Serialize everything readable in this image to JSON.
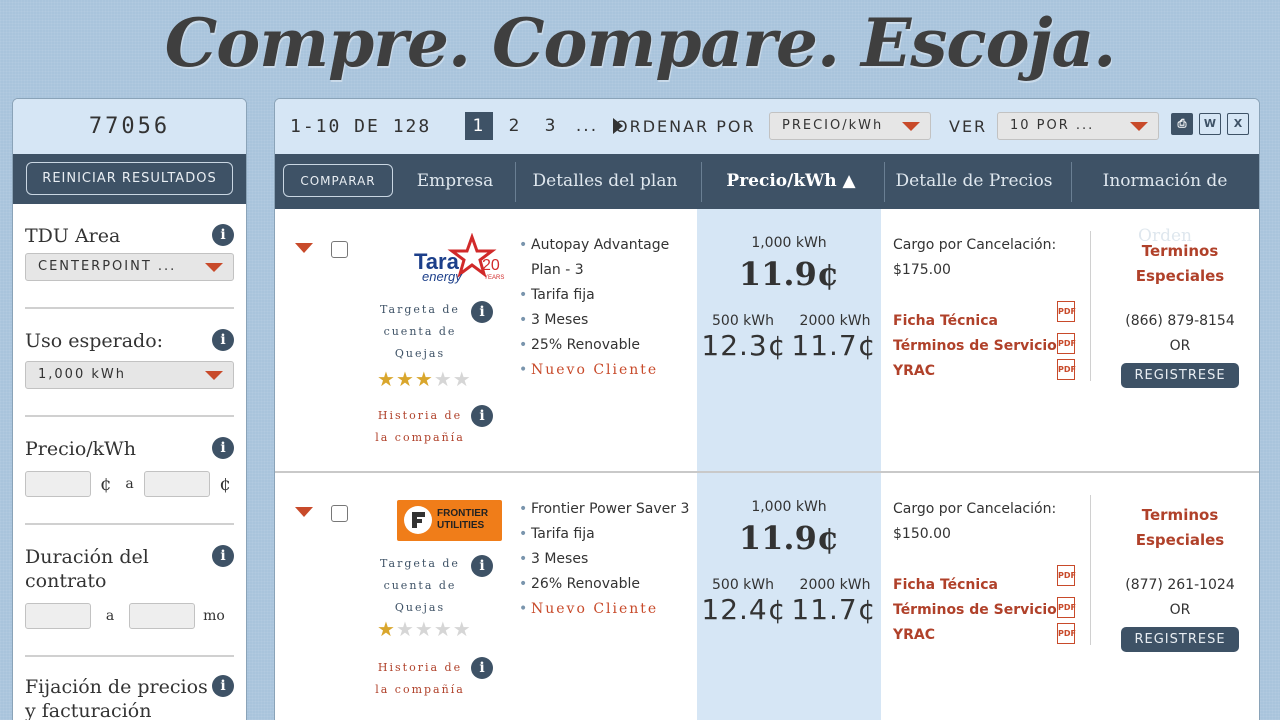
{
  "hero": {
    "title": "Compre. Compare. Escoja."
  },
  "sidebar": {
    "zip": "77056",
    "reset_label": "REINICIAR RESULTADOS",
    "tdu": {
      "label": "TDU Area",
      "value": "CENTERPOINT ..."
    },
    "usage": {
      "label": "Uso esperado:",
      "value": "1,000 kWh"
    },
    "price": {
      "label": "Precio/kWh",
      "unit": "¢",
      "to": "a"
    },
    "term": {
      "label_line1": "Duración del",
      "label_line2": "contrato",
      "to": "a",
      "unit": "mo"
    },
    "pricing": {
      "label_line1": "Fijación de precios",
      "label_line2": "y facturación"
    }
  },
  "toolbar": {
    "count": "1-10 DE 128",
    "pages": [
      "1",
      "2",
      "3",
      "..."
    ],
    "sort_label": "ORDENAR POR",
    "sort_value": "PRECIO/kWh",
    "view_label": "VER",
    "view_value": "10 POR ..."
  },
  "table": {
    "compare_label": "COMPARAR",
    "headers": [
      "Empresa",
      "Detalles del plan",
      "Precio/kWh ▲",
      "Detalle de Precios",
      "Inormación de Orden"
    ]
  },
  "plans": [
    {
      "company": "Tara Energy",
      "logo_text": "Tara",
      "logo_sub": "energy",
      "logo_years": "20",
      "logo_years_label": "YEARS",
      "complaints_line1": "Targeta de",
      "complaints_line2": "cuenta de",
      "complaints_line3": "Quejas",
      "rating": 3,
      "history_line1": "Historia de",
      "history_line2": "la compañía",
      "details": [
        "Autopay Advantage",
        "Plan - 3",
        "Tarifa fija",
        "3 Meses",
        "25% Renovable"
      ],
      "badge": "Nuevo Cliente",
      "price_1000_label": "1,000 kWh",
      "price_1000": "11.9¢",
      "price_500_label": "500 kWh",
      "price_500": "12.3¢",
      "price_2000_label": "2000 kWh",
      "price_2000": "11.7¢",
      "cancel_label": "Cargo por Cancelación:",
      "cancel_value": "$175.00",
      "docs": [
        "Ficha Técnica",
        "Términos de Servicio",
        "YRAC"
      ],
      "terms_line1": "Terminos",
      "terms_line2": "Especiales",
      "phone": "(866) 879-8154",
      "or": "OR",
      "register": "REGISTRESE"
    },
    {
      "company": "Frontier Utilities",
      "logo_text": "FRONTIER UTILITIES",
      "complaints_line1": "Targeta de",
      "complaints_line2": "cuenta de",
      "complaints_line3": "Quejas",
      "rating": 1,
      "history_line1": "Historia de",
      "history_line2": "la compañía",
      "details": [
        "Frontier Power Saver 3",
        "Tarifa fija",
        "3 Meses",
        "26% Renovable"
      ],
      "badge": "Nuevo Cliente",
      "price_1000_label": "1,000 kWh",
      "price_1000": "11.9¢",
      "price_500_label": "500 kWh",
      "price_500": "12.4¢",
      "price_2000_label": "2000 kWh",
      "price_2000": "11.7¢",
      "cancel_label": "Cargo por Cancelación:",
      "cancel_value": "$150.00",
      "docs": [
        "Ficha Técnica",
        "Términos de Servicio",
        "YRAC"
      ],
      "terms_line1": "Terminos",
      "terms_line2": "Especiales",
      "phone": "(877) 261-1024",
      "or": "OR",
      "register": "REGISTRESE"
    }
  ],
  "colors": {
    "accent": "#c84a2a",
    "navy": "#3e5266",
    "light_blue": "#d6e6f5",
    "star": "#d9a62c"
  }
}
